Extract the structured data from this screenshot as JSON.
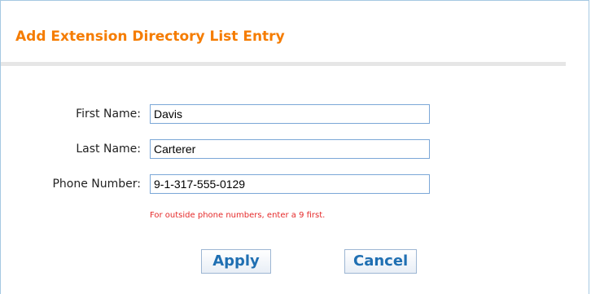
{
  "dialog": {
    "title": "Add Extension Directory List Entry",
    "fields": [
      {
        "label": "First Name:",
        "value": "Davis"
      },
      {
        "label": "Last Name:",
        "value": "Carterer"
      },
      {
        "label": "Phone Number:",
        "value": "9-1-317-555-0129"
      }
    ],
    "hint": "For outside phone numbers, enter a 9 first.",
    "buttons": {
      "apply": "Apply",
      "cancel": "Cancel"
    },
    "colors": {
      "title": "#f57c00",
      "hint": "#e52a2a",
      "button_text": "#1f6fb2",
      "field_border": "#7ba7d7"
    }
  }
}
